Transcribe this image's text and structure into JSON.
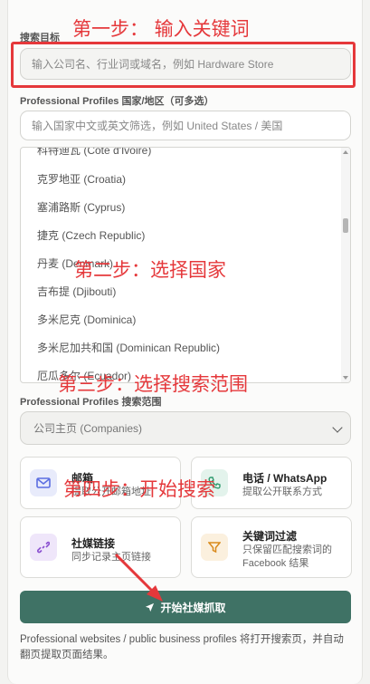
{
  "search_target": {
    "label": "搜索目标",
    "placeholder": "输入公司名、行业词或域名，例如 Hardware Store"
  },
  "countries": {
    "label": "Professional Profiles 国家/地区（可多选）",
    "filter_placeholder": "输入国家中文或英文筛选，例如 United States / 美国",
    "items": [
      "科特迪瓦 (Côte d'Ivoire)",
      "克罗地亚 (Croatia)",
      "塞浦路斯 (Cyprus)",
      "捷克 (Czech Republic)",
      "丹麦 (Denmark)",
      "吉布提 (Djibouti)",
      "多米尼克 (Dominica)",
      "多米尼加共和国 (Dominican Republic)",
      "厄瓜多尔 (Ecuador)"
    ]
  },
  "scope": {
    "label": "Professional Profiles 搜索范围",
    "selected": "公司主页 (Companies)"
  },
  "cards": [
    {
      "title": "邮箱",
      "desc": "提取公开邮箱地址",
      "icon": "mail-icon",
      "color": "#5b6ee1",
      "bg": "#e8ebfb"
    },
    {
      "title": "电话 / WhatsApp",
      "desc": "提取公开联系方式",
      "icon": "phone-icon",
      "color": "#2f9a6e",
      "bg": "#e3f3ec"
    },
    {
      "title": "社媒链接",
      "desc": "同步记录主页链接",
      "icon": "link-icon",
      "color": "#8a4fd0",
      "bg": "#efe6fa"
    },
    {
      "title": "关键词过滤",
      "desc": "只保留匹配搜索词的 Facebook 结果",
      "icon": "filter-icon",
      "color": "#d98a1c",
      "bg": "#fbf0de"
    }
  ],
  "start_button": {
    "label": "开始社媒抓取"
  },
  "footer": {
    "text": "Professional websites / public business profiles 将打开搜索页，并自动翻页提取页面结果。"
  },
  "annotations": {
    "step1": "第一步： 输入关键词",
    "step2": "第二步：选择国家",
    "step3": "第三步：选择搜索范围",
    "step4": "第四步：开始搜索"
  },
  "colors": {
    "accent": "#3f7265",
    "annotation": "#e5383b"
  }
}
